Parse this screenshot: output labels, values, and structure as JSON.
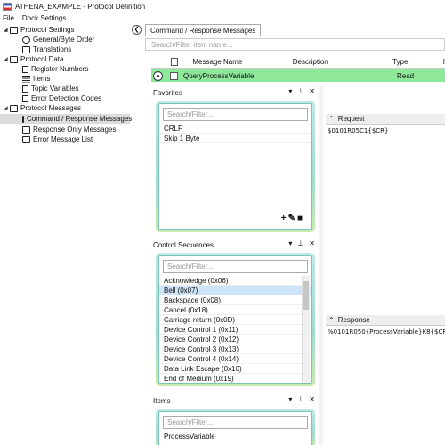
{
  "window": {
    "title": "ATHENA_EXAMPLE - Protocol Definition"
  },
  "menu": [
    "File",
    "Dock Settings"
  ],
  "tree": [
    {
      "label": "Protocol Settings",
      "icon": "settings-folder-icon",
      "expanded": true
    },
    {
      "label": "General/Byte Order",
      "icon": "byte-order-icon"
    },
    {
      "label": "Translations",
      "icon": "translations-icon"
    },
    {
      "label": "Protocol Data",
      "icon": "data-folder-icon",
      "expanded": true
    },
    {
      "label": "Register Numbers",
      "icon": "register-icon"
    },
    {
      "label": "Items",
      "icon": "list-icon"
    },
    {
      "label": "Topic Variables",
      "icon": "document-icon"
    },
    {
      "label": "Error Detection Codes",
      "icon": "document-icon"
    },
    {
      "label": "Protocol Messages",
      "icon": "messages-folder-icon",
      "expanded": true
    },
    {
      "label": "Command / Response Messages",
      "icon": "command-response-icon",
      "selected": true
    },
    {
      "label": "Response Only Messages",
      "icon": "response-only-icon"
    },
    {
      "label": "Error Message List",
      "icon": "error-list-icon"
    }
  ],
  "doc_tab": "Command / Response Messages",
  "filter_placeholder": "Search/Filter item name...",
  "grid": {
    "columns": [
      "Message Name",
      "Description",
      "Type",
      "I"
    ],
    "row": {
      "name": "QueryProcessVariable",
      "description": "",
      "type": "Read"
    },
    "row_color": "#8fe79a"
  },
  "favorites": {
    "title": "Favorites",
    "search_placeholder": "Search/Filter...",
    "items": [
      "CRLF",
      "Skip 1 Byte"
    ],
    "tools": "+ ✎ 🗑"
  },
  "control_sequences": {
    "title": "Control Sequences",
    "search_placeholder": "Search/Filter...",
    "items": [
      "Acknowledge (0x06)",
      "Bell (0x07)",
      "Backspace (0x08)",
      "Cancel (0x18)",
      "Carriage return (0x0D)",
      "Device Control 1 (0x11)",
      "Device Control 2 (0x12)",
      "Device Control 3 (0x13)",
      "Device Control 4 (0x14)",
      "Data Link Escape (0x10)",
      "End of Medium (0x19)"
    ],
    "highlighted_index": 1
  },
  "items_panel": {
    "title": "Items",
    "search_placeholder": "Search/Filter...",
    "items": [
      "ProcessVariable"
    ]
  },
  "request": {
    "title": "Request",
    "content": "$0101R05C1{$CR}"
  },
  "response": {
    "title": "Response",
    "content": "%0101R050{ProcessVariable}K8{$CR}"
  },
  "panel_controls": {
    "dropdown": "▾",
    "pin": "⊥",
    "close": "✕"
  }
}
